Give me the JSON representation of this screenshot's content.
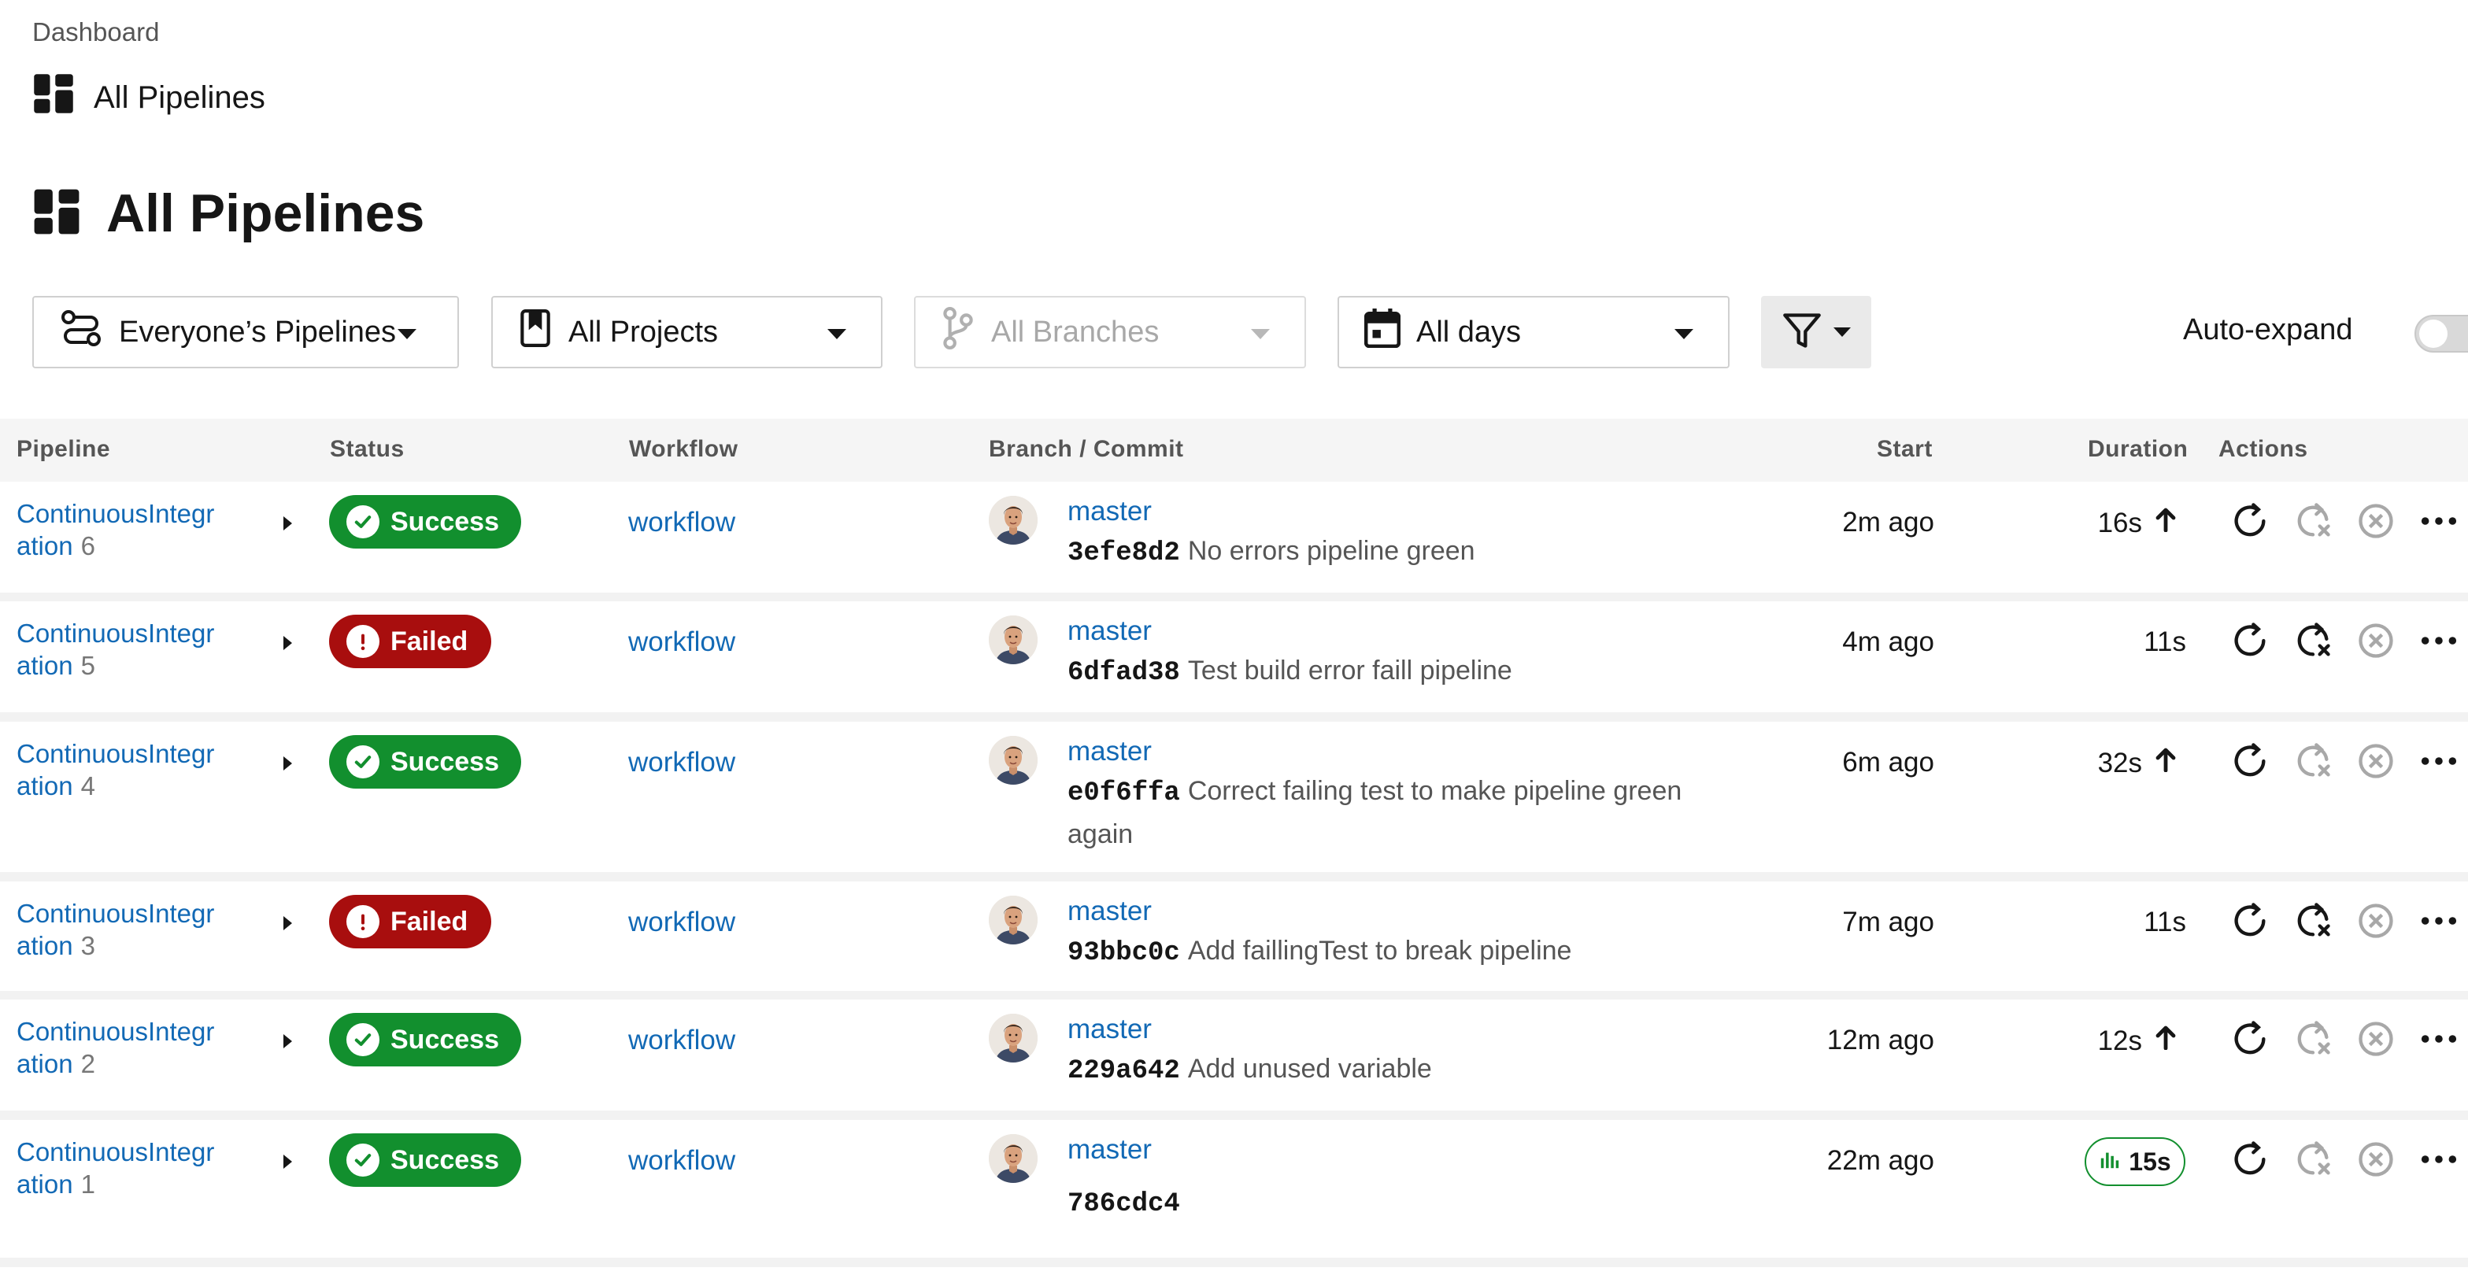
{
  "breadcrumb": {
    "root": "Dashboard",
    "current": "All Pipelines"
  },
  "page": {
    "title": "All Pipelines"
  },
  "filters": {
    "pipelines": "Everyone’s Pipelines",
    "projects": "All Projects",
    "branches": "All Branches",
    "days": "All days",
    "auto_expand_label": "Auto-expand",
    "auto_expand_on": false
  },
  "table": {
    "headers": {
      "pipeline": "Pipeline",
      "status": "Status",
      "workflow": "Workflow",
      "branch_commit": "Branch / Commit",
      "start": "Start",
      "duration": "Duration",
      "actions": "Actions"
    },
    "rows": [
      {
        "name": "ContinuousIntegr ation",
        "name_l1": "ContinuousIntegr",
        "name_l2": "ation",
        "number": "6",
        "status": "Success",
        "workflow": "workflow",
        "branch": "master",
        "hash": "3efe8d2",
        "message": "No errors pipeline green",
        "start": "2m ago",
        "duration": "16s",
        "trend": "up"
      },
      {
        "name": "ContinuousIntegr ation",
        "name_l1": "ContinuousIntegr",
        "name_l2": "ation",
        "number": "5",
        "status": "Failed",
        "workflow": "workflow",
        "branch": "master",
        "hash": "6dfad38",
        "message": "Test build error faill pipeline",
        "start": "4m ago",
        "duration": "11s",
        "trend": "none"
      },
      {
        "name": "ContinuousIntegr ation",
        "name_l1": "ContinuousIntegr",
        "name_l2": "ation",
        "number": "4",
        "status": "Success",
        "workflow": "workflow",
        "branch": "master",
        "hash": "e0f6ffa",
        "message": "Correct failing test to make pipeline green again",
        "start": "6m ago",
        "duration": "32s",
        "trend": "up"
      },
      {
        "name": "ContinuousIntegr ation",
        "name_l1": "ContinuousIntegr",
        "name_l2": "ation",
        "number": "3",
        "status": "Failed",
        "workflow": "workflow",
        "branch": "master",
        "hash": "93bbc0c",
        "message": "Add faillingTest to break pipeline",
        "start": "7m ago",
        "duration": "11s",
        "trend": "none"
      },
      {
        "name": "ContinuousIntegr ation",
        "name_l1": "ContinuousIntegr",
        "name_l2": "ation",
        "number": "2",
        "status": "Success",
        "workflow": "workflow",
        "branch": "master",
        "hash": "229a642",
        "message": "Add unused variable",
        "start": "12m ago",
        "duration": "12s",
        "trend": "up"
      },
      {
        "name": "ContinuousIntegr ation",
        "name_l1": "ContinuousIntegr",
        "name_l2": "ation",
        "number": "1",
        "status": "Success",
        "workflow": "workflow",
        "branch": "master",
        "hash": "786cdc4",
        "message": "",
        "start": "22m ago",
        "duration": "15s",
        "trend": "insights"
      }
    ]
  },
  "colors": {
    "success": "#128f2e",
    "failed": "#a80e0e",
    "link": "#1269b5"
  },
  "icons": [
    "dashboard-icon",
    "pipelines-icon",
    "project-icon",
    "branch-icon",
    "calendar-icon",
    "filter-icon",
    "check-icon",
    "alert-icon",
    "arrow-up-icon",
    "insights-icon",
    "rerun-icon",
    "rerun-failed-icon",
    "cancel-icon",
    "more-icon"
  ]
}
